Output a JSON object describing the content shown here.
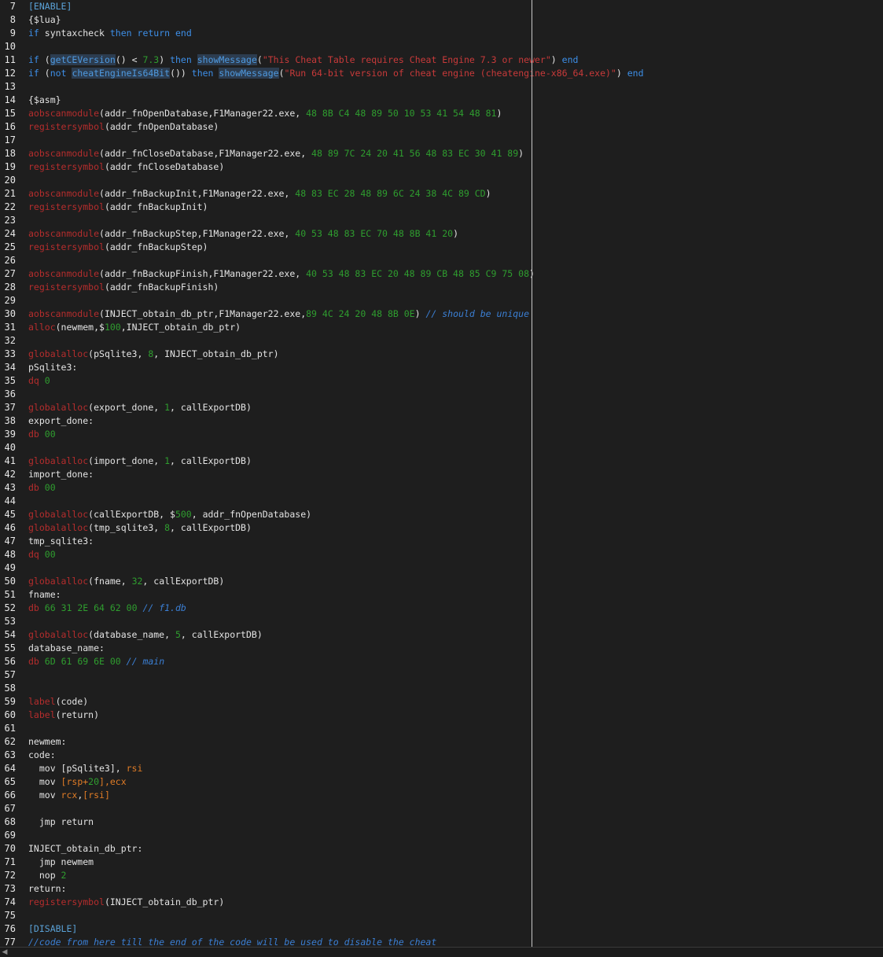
{
  "editor": {
    "lines": [
      {
        "n": "7",
        "tokens": [
          {
            "t": "[ENABLE]",
            "c": "section"
          }
        ]
      },
      {
        "n": "8",
        "tokens": [
          {
            "t": "{$lua}",
            "c": "default"
          }
        ]
      },
      {
        "n": "9",
        "tokens": [
          {
            "t": "if",
            "c": "keyword"
          },
          {
            "t": " syntaxcheck ",
            "c": "default"
          },
          {
            "t": "then",
            "c": "keyword"
          },
          {
            "t": " ",
            "c": "default"
          },
          {
            "t": "return",
            "c": "keyword"
          },
          {
            "t": " ",
            "c": "default"
          },
          {
            "t": "end",
            "c": "keyword"
          }
        ]
      },
      {
        "n": "10",
        "tokens": []
      },
      {
        "n": "11",
        "tokens": [
          {
            "t": "if",
            "c": "keyword"
          },
          {
            "t": " (",
            "c": "default"
          },
          {
            "t": "getCEVersion",
            "c": "funchl"
          },
          {
            "t": "() < ",
            "c": "default"
          },
          {
            "t": "7.3",
            "c": "number"
          },
          {
            "t": ") ",
            "c": "default"
          },
          {
            "t": "then",
            "c": "keyword"
          },
          {
            "t": " ",
            "c": "default"
          },
          {
            "t": "showMessage",
            "c": "funchl"
          },
          {
            "t": "(",
            "c": "default"
          },
          {
            "t": "\"This Cheat Table requires Cheat Engine 7.3 or newer\"",
            "c": "string"
          },
          {
            "t": ") ",
            "c": "default"
          },
          {
            "t": "end",
            "c": "keyword"
          }
        ]
      },
      {
        "n": "12",
        "tokens": [
          {
            "t": "if",
            "c": "keyword"
          },
          {
            "t": " (",
            "c": "default"
          },
          {
            "t": "not",
            "c": "keyword"
          },
          {
            "t": " ",
            "c": "default"
          },
          {
            "t": "cheatEngineIs64Bit",
            "c": "funchl"
          },
          {
            "t": "()) ",
            "c": "default"
          },
          {
            "t": "then",
            "c": "keyword"
          },
          {
            "t": " ",
            "c": "default"
          },
          {
            "t": "showMessage",
            "c": "funchl"
          },
          {
            "t": "(",
            "c": "default"
          },
          {
            "t": "\"Run 64-bit version of cheat engine (cheatengine-x86_64.exe)\"",
            "c": "string"
          },
          {
            "t": ") ",
            "c": "default"
          },
          {
            "t": "end",
            "c": "keyword"
          }
        ]
      },
      {
        "n": "13",
        "tokens": []
      },
      {
        "n": "14",
        "tokens": [
          {
            "t": "{$asm}",
            "c": "default"
          }
        ]
      },
      {
        "n": "15",
        "tokens": [
          {
            "t": "aobscanmodule",
            "c": "directive"
          },
          {
            "t": "(addr_fnOpenDatabase,F1Manager22.exe, ",
            "c": "default"
          },
          {
            "t": "48 8B C4 48 89 50 10 53 41 54 48 81",
            "c": "number"
          },
          {
            "t": ")",
            "c": "default"
          }
        ]
      },
      {
        "n": "16",
        "tokens": [
          {
            "t": "registersymbol",
            "c": "directive"
          },
          {
            "t": "(addr_fnOpenDatabase)",
            "c": "default"
          }
        ]
      },
      {
        "n": "17",
        "tokens": []
      },
      {
        "n": "18",
        "tokens": [
          {
            "t": "aobscanmodule",
            "c": "directive"
          },
          {
            "t": "(addr_fnCloseDatabase,F1Manager22.exe, ",
            "c": "default"
          },
          {
            "t": "48 89 7C 24 20 41 56 48 83 EC 30 41 89",
            "c": "number"
          },
          {
            "t": ")",
            "c": "default"
          }
        ]
      },
      {
        "n": "19",
        "tokens": [
          {
            "t": "registersymbol",
            "c": "directive"
          },
          {
            "t": "(addr_fnCloseDatabase)",
            "c": "default"
          }
        ]
      },
      {
        "n": "20",
        "tokens": []
      },
      {
        "n": "21",
        "tokens": [
          {
            "t": "aobscanmodule",
            "c": "directive"
          },
          {
            "t": "(addr_fnBackupInit,F1Manager22.exe, ",
            "c": "default"
          },
          {
            "t": "48 83 EC 28 48 89 6C 24 38 4C 89 CD",
            "c": "number"
          },
          {
            "t": ")",
            "c": "default"
          }
        ]
      },
      {
        "n": "22",
        "tokens": [
          {
            "t": "registersymbol",
            "c": "directive"
          },
          {
            "t": "(addr_fnBackupInit)",
            "c": "default"
          }
        ]
      },
      {
        "n": "23",
        "tokens": []
      },
      {
        "n": "24",
        "tokens": [
          {
            "t": "aobscanmodule",
            "c": "directive"
          },
          {
            "t": "(addr_fnBackupStep,F1Manager22.exe, ",
            "c": "default"
          },
          {
            "t": "40 53 48 83 EC 70 48 8B 41 20",
            "c": "number"
          },
          {
            "t": ")",
            "c": "default"
          }
        ]
      },
      {
        "n": "25",
        "tokens": [
          {
            "t": "registersymbol",
            "c": "directive"
          },
          {
            "t": "(addr_fnBackupStep)",
            "c": "default"
          }
        ]
      },
      {
        "n": "26",
        "tokens": []
      },
      {
        "n": "27",
        "tokens": [
          {
            "t": "aobscanmodule",
            "c": "directive"
          },
          {
            "t": "(addr_fnBackupFinish,F1Manager22.exe, ",
            "c": "default"
          },
          {
            "t": "40 53 48 83 EC 20 48 89 CB 48 85 C9 75 08",
            "c": "number"
          },
          {
            "t": ")",
            "c": "default"
          }
        ]
      },
      {
        "n": "28",
        "tokens": [
          {
            "t": "registersymbol",
            "c": "directive"
          },
          {
            "t": "(addr_fnBackupFinish)",
            "c": "default"
          }
        ]
      },
      {
        "n": "29",
        "tokens": []
      },
      {
        "n": "30",
        "tokens": [
          {
            "t": "aobscanmodule",
            "c": "directive"
          },
          {
            "t": "(INJECT_obtain_db_ptr,F1Manager22.exe,",
            "c": "default"
          },
          {
            "t": "89 4C 24 20 48 8B 0E",
            "c": "number"
          },
          {
            "t": ") ",
            "c": "default"
          },
          {
            "t": "// should be unique",
            "c": "comment"
          }
        ]
      },
      {
        "n": "31",
        "tokens": [
          {
            "t": "alloc",
            "c": "directive"
          },
          {
            "t": "(newmem,$",
            "c": "default"
          },
          {
            "t": "100",
            "c": "number"
          },
          {
            "t": ",INJECT_obtain_db_ptr)",
            "c": "default"
          }
        ]
      },
      {
        "n": "32",
        "tokens": []
      },
      {
        "n": "33",
        "tokens": [
          {
            "t": "globalalloc",
            "c": "directive"
          },
          {
            "t": "(pSqlite3, ",
            "c": "default"
          },
          {
            "t": "8",
            "c": "number"
          },
          {
            "t": ", INJECT_obtain_db_ptr)",
            "c": "default"
          }
        ]
      },
      {
        "n": "34",
        "tokens": [
          {
            "t": "pSqlite3:",
            "c": "default"
          }
        ]
      },
      {
        "n": "35",
        "tokens": [
          {
            "t": "dq",
            "c": "directive"
          },
          {
            "t": " ",
            "c": "default"
          },
          {
            "t": "0",
            "c": "number"
          }
        ]
      },
      {
        "n": "36",
        "tokens": []
      },
      {
        "n": "37",
        "tokens": [
          {
            "t": "globalalloc",
            "c": "directive"
          },
          {
            "t": "(export_done, ",
            "c": "default"
          },
          {
            "t": "1",
            "c": "number"
          },
          {
            "t": ", callExportDB)",
            "c": "default"
          }
        ]
      },
      {
        "n": "38",
        "tokens": [
          {
            "t": "export_done:",
            "c": "default"
          }
        ]
      },
      {
        "n": "39",
        "tokens": [
          {
            "t": "db",
            "c": "directive"
          },
          {
            "t": " ",
            "c": "default"
          },
          {
            "t": "00",
            "c": "number"
          }
        ]
      },
      {
        "n": "40",
        "tokens": []
      },
      {
        "n": "41",
        "tokens": [
          {
            "t": "globalalloc",
            "c": "directive"
          },
          {
            "t": "(import_done, ",
            "c": "default"
          },
          {
            "t": "1",
            "c": "number"
          },
          {
            "t": ", callExportDB)",
            "c": "default"
          }
        ]
      },
      {
        "n": "42",
        "tokens": [
          {
            "t": "import_done:",
            "c": "default"
          }
        ]
      },
      {
        "n": "43",
        "tokens": [
          {
            "t": "db",
            "c": "directive"
          },
          {
            "t": " ",
            "c": "default"
          },
          {
            "t": "00",
            "c": "number"
          }
        ]
      },
      {
        "n": "44",
        "tokens": []
      },
      {
        "n": "45",
        "tokens": [
          {
            "t": "globalalloc",
            "c": "directive"
          },
          {
            "t": "(callExportDB, $",
            "c": "default"
          },
          {
            "t": "500",
            "c": "number"
          },
          {
            "t": ", addr_fnOpenDatabase)",
            "c": "default"
          }
        ]
      },
      {
        "n": "46",
        "tokens": [
          {
            "t": "globalalloc",
            "c": "directive"
          },
          {
            "t": "(tmp_sqlite3, ",
            "c": "default"
          },
          {
            "t": "8",
            "c": "number"
          },
          {
            "t": ", callExportDB)",
            "c": "default"
          }
        ]
      },
      {
        "n": "47",
        "tokens": [
          {
            "t": "tmp_sqlite3:",
            "c": "default"
          }
        ]
      },
      {
        "n": "48",
        "tokens": [
          {
            "t": "dq",
            "c": "directive"
          },
          {
            "t": " ",
            "c": "default"
          },
          {
            "t": "00",
            "c": "number"
          }
        ]
      },
      {
        "n": "49",
        "tokens": []
      },
      {
        "n": "50",
        "tokens": [
          {
            "t": "globalalloc",
            "c": "directive"
          },
          {
            "t": "(fname, ",
            "c": "default"
          },
          {
            "t": "32",
            "c": "number"
          },
          {
            "t": ", callExportDB)",
            "c": "default"
          }
        ]
      },
      {
        "n": "51",
        "tokens": [
          {
            "t": "fname:",
            "c": "default"
          }
        ]
      },
      {
        "n": "52",
        "tokens": [
          {
            "t": "db",
            "c": "directive"
          },
          {
            "t": " ",
            "c": "default"
          },
          {
            "t": "66 31 2E 64 62 00",
            "c": "number"
          },
          {
            "t": " ",
            "c": "default"
          },
          {
            "t": "// f1.db",
            "c": "comment"
          }
        ]
      },
      {
        "n": "53",
        "tokens": []
      },
      {
        "n": "54",
        "tokens": [
          {
            "t": "globalalloc",
            "c": "directive"
          },
          {
            "t": "(database_name, ",
            "c": "default"
          },
          {
            "t": "5",
            "c": "number"
          },
          {
            "t": ", callExportDB)",
            "c": "default"
          }
        ]
      },
      {
        "n": "55",
        "tokens": [
          {
            "t": "database_name:",
            "c": "default"
          }
        ]
      },
      {
        "n": "56",
        "tokens": [
          {
            "t": "db",
            "c": "directive"
          },
          {
            "t": " ",
            "c": "default"
          },
          {
            "t": "6D 61 69 6E 00",
            "c": "number"
          },
          {
            "t": " ",
            "c": "default"
          },
          {
            "t": "// main",
            "c": "comment"
          }
        ]
      },
      {
        "n": "57",
        "tokens": []
      },
      {
        "n": "58",
        "tokens": []
      },
      {
        "n": "59",
        "tokens": [
          {
            "t": "label",
            "c": "directive"
          },
          {
            "t": "(code)",
            "c": "default"
          }
        ]
      },
      {
        "n": "60",
        "tokens": [
          {
            "t": "label",
            "c": "directive"
          },
          {
            "t": "(return)",
            "c": "default"
          }
        ]
      },
      {
        "n": "61",
        "tokens": []
      },
      {
        "n": "62",
        "tokens": [
          {
            "t": "newmem:",
            "c": "default"
          }
        ]
      },
      {
        "n": "63",
        "tokens": [
          {
            "t": "code:",
            "c": "default"
          }
        ]
      },
      {
        "n": "64",
        "tokens": [
          {
            "t": "  mov [pSqlite3], ",
            "c": "default"
          },
          {
            "t": "rsi",
            "c": "register"
          }
        ]
      },
      {
        "n": "65",
        "tokens": [
          {
            "t": "  mov ",
            "c": "default"
          },
          {
            "t": "[rsp+",
            "c": "register"
          },
          {
            "t": "20",
            "c": "number"
          },
          {
            "t": "],ecx",
            "c": "register"
          }
        ]
      },
      {
        "n": "66",
        "tokens": [
          {
            "t": "  mov ",
            "c": "default"
          },
          {
            "t": "rcx",
            "c": "register"
          },
          {
            "t": ",",
            "c": "default"
          },
          {
            "t": "[rsi]",
            "c": "register"
          }
        ]
      },
      {
        "n": "67",
        "tokens": []
      },
      {
        "n": "68",
        "tokens": [
          {
            "t": "  jmp return",
            "c": "default"
          }
        ]
      },
      {
        "n": "69",
        "tokens": []
      },
      {
        "n": "70",
        "tokens": [
          {
            "t": "INJECT_obtain_db_ptr:",
            "c": "default"
          }
        ]
      },
      {
        "n": "71",
        "tokens": [
          {
            "t": "  jmp newmem",
            "c": "default"
          }
        ]
      },
      {
        "n": "72",
        "tokens": [
          {
            "t": "  nop ",
            "c": "default"
          },
          {
            "t": "2",
            "c": "number"
          }
        ]
      },
      {
        "n": "73",
        "tokens": [
          {
            "t": "return:",
            "c": "default"
          }
        ]
      },
      {
        "n": "74",
        "tokens": [
          {
            "t": "registersymbol",
            "c": "directive"
          },
          {
            "t": "(INJECT_obtain_db_ptr)",
            "c": "default"
          }
        ]
      },
      {
        "n": "75",
        "tokens": []
      },
      {
        "n": "76",
        "tokens": [
          {
            "t": "[DISABLE]",
            "c": "section"
          }
        ]
      },
      {
        "n": "77",
        "tokens": [
          {
            "t": "//code from here till the end of the code will be used to disable the cheat",
            "c": "comment"
          }
        ]
      }
    ]
  },
  "scrollbar": {
    "left_arrow_glyph": "◀"
  },
  "colors": {
    "background": "#1e1e1e",
    "default_text": "#e4e4e4",
    "keyword": "#3d8fe8",
    "string": "#c83a3a",
    "number": "#2f9e2f",
    "directive": "#b52d2d",
    "register": "#e07c26",
    "comment": "#3b7fd4",
    "highlight_background": "#2c3c4f",
    "section": "#5aa1d6"
  }
}
